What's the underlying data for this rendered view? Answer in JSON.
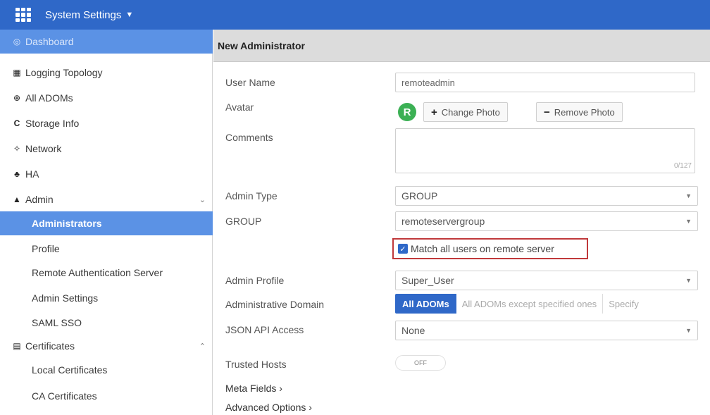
{
  "header": {
    "title": "System Settings",
    "chevron_icon": "chevron-down-icon"
  },
  "sidebar": {
    "items": [
      {
        "label": "Dashboard",
        "icon": "dashboard-icon",
        "glyph": "◎"
      },
      {
        "label": "Logging Topology",
        "icon": "topology-icon",
        "glyph": "▦"
      },
      {
        "label": "All ADOMs",
        "icon": "globe-icon",
        "glyph": "⊕"
      },
      {
        "label": "Storage Info",
        "icon": "storage-icon",
        "glyph": "C"
      },
      {
        "label": "Network",
        "icon": "network-icon",
        "glyph": "✧"
      },
      {
        "label": "HA",
        "icon": "ha-icon",
        "glyph": "♣"
      },
      {
        "label": "Admin",
        "icon": "user-icon",
        "glyph": "▲"
      },
      {
        "label": "Administrators"
      },
      {
        "label": "Profile"
      },
      {
        "label": "Remote Authentication Server"
      },
      {
        "label": "Admin Settings"
      },
      {
        "label": "SAML SSO"
      },
      {
        "label": "Certificates",
        "icon": "certificate-icon",
        "glyph": "▤"
      },
      {
        "label": "Local Certificates"
      },
      {
        "label": "CA Certificates"
      }
    ]
  },
  "main": {
    "title": "New Administrator",
    "fields": {
      "user_name_label": "User Name",
      "user_name_value": "remoteadmin",
      "avatar_label": "Avatar",
      "avatar_letter": "R",
      "change_photo": "Change Photo",
      "remove_photo": "Remove Photo",
      "comments_label": "Comments",
      "comments_counter": "0/127",
      "admin_type_label": "Admin Type",
      "admin_type_value": "GROUP",
      "group_label": "GROUP",
      "group_value": "remoteservergroup",
      "match_all_label": "Match all users on remote server",
      "admin_profile_label": "Admin Profile",
      "admin_profile_value": "Super_User",
      "admin_domain_label": "Administrative Domain",
      "domain_option_all": "All ADOMs",
      "domain_option_except": "All ADOMs except specified ones",
      "domain_option_specify": "Specify",
      "json_api_label": "JSON API Access",
      "json_api_value": "None",
      "trusted_hosts_label": "Trusted Hosts",
      "trusted_hosts_toggle": "OFF",
      "meta_fields": "Meta Fields",
      "advanced_options": "Advanced Options"
    }
  },
  "colors": {
    "header": "#2f68c8",
    "active_nav": "#5b92e5",
    "highlight_border": "#c0393b",
    "avatar": "#3bb054"
  }
}
